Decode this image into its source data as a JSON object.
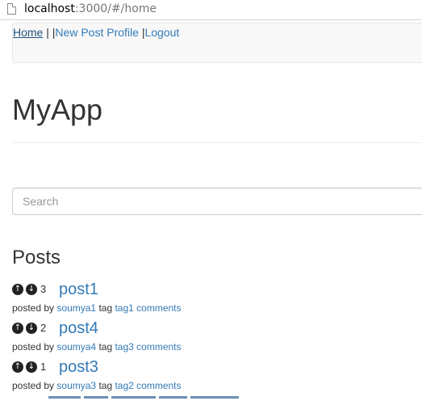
{
  "browser": {
    "url_host": "localhost",
    "url_rest": ":3000/#/home"
  },
  "nav": {
    "home": "Home",
    "sep1": "| |",
    "new_post": "New Post",
    "profile": "Profile",
    "sep2": "|",
    "logout": "Logout"
  },
  "app_title": "MyApp",
  "search": {
    "placeholder": "Search"
  },
  "posts_heading": "Posts",
  "posts": [
    {
      "score": "3",
      "title": "post1",
      "posted_by": "posted by",
      "author": "soumya1",
      "tag_label": "tag",
      "tag": "tag1",
      "comments": "comments"
    },
    {
      "score": "2",
      "title": "post4",
      "posted_by": "posted by",
      "author": "soumya4",
      "tag_label": "tag",
      "tag": "tag3",
      "comments": "comments"
    },
    {
      "score": "1",
      "title": "post3",
      "posted_by": "posted by",
      "author": "soumya3",
      "tag_label": "tag",
      "tag": "tag2",
      "comments": "comments"
    }
  ],
  "icons": {
    "upvote": "arrow-up-circle-icon",
    "downvote": "arrow-down-circle-icon"
  },
  "colors": {
    "link": "#337ab7",
    "navbar_bg": "#f8f8f8",
    "text": "#333333"
  }
}
